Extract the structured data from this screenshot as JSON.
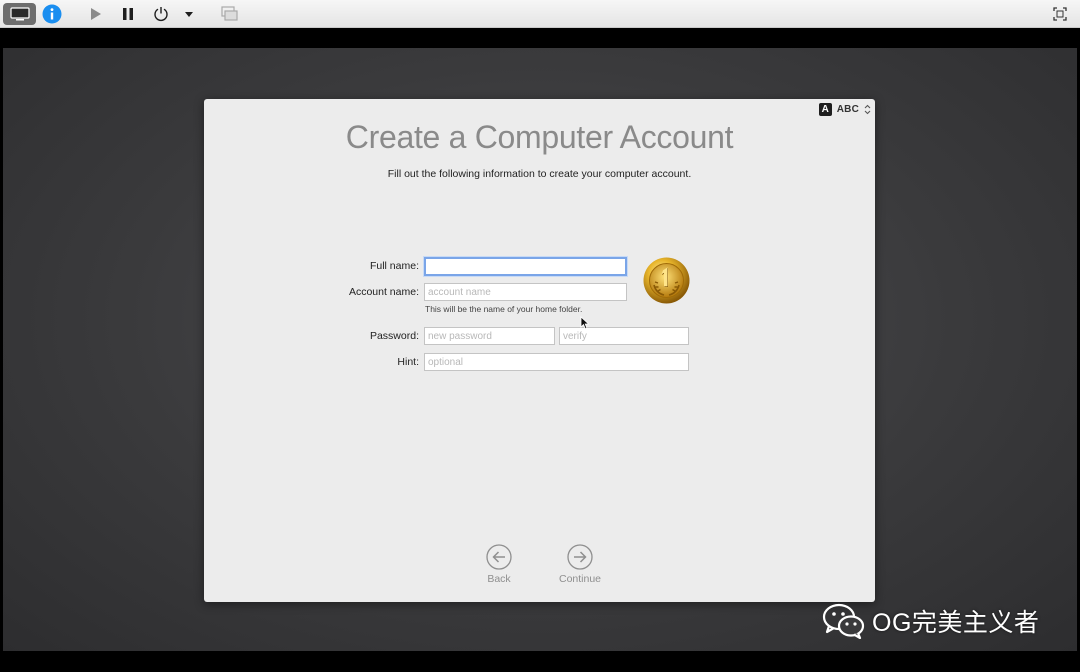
{
  "input_menu": {
    "badge": "A",
    "label": "ABC"
  },
  "setup": {
    "title": "Create a Computer Account",
    "subtitle": "Fill out the following information to create your computer account."
  },
  "form": {
    "full_name": {
      "label": "Full name:",
      "value": "",
      "placeholder": ""
    },
    "account_name": {
      "label": "Account name:",
      "value": "",
      "placeholder": "account name",
      "help": "This will be the name of your home folder."
    },
    "password": {
      "label": "Password:",
      "value": "",
      "placeholder": "new password"
    },
    "verify": {
      "value": "",
      "placeholder": "verify"
    },
    "hint": {
      "label": "Hint:",
      "value": "",
      "placeholder": "optional"
    }
  },
  "nav": {
    "back_label": "Back",
    "continue_label": "Continue"
  },
  "watermark": {
    "text": "OG完美主义者"
  },
  "icons": {
    "toolbar": [
      "display-icon",
      "info-icon",
      "play-icon",
      "pause-icon",
      "power-icon",
      "chevron-down-icon",
      "snapshot-icon",
      "fullscreen-icon"
    ],
    "avatar": "gold-medal-icon"
  },
  "colors": {
    "focus_ring": "#7aa5e8",
    "info_blue": "#1a8ef0",
    "avatar_gold": "#d9a520"
  }
}
